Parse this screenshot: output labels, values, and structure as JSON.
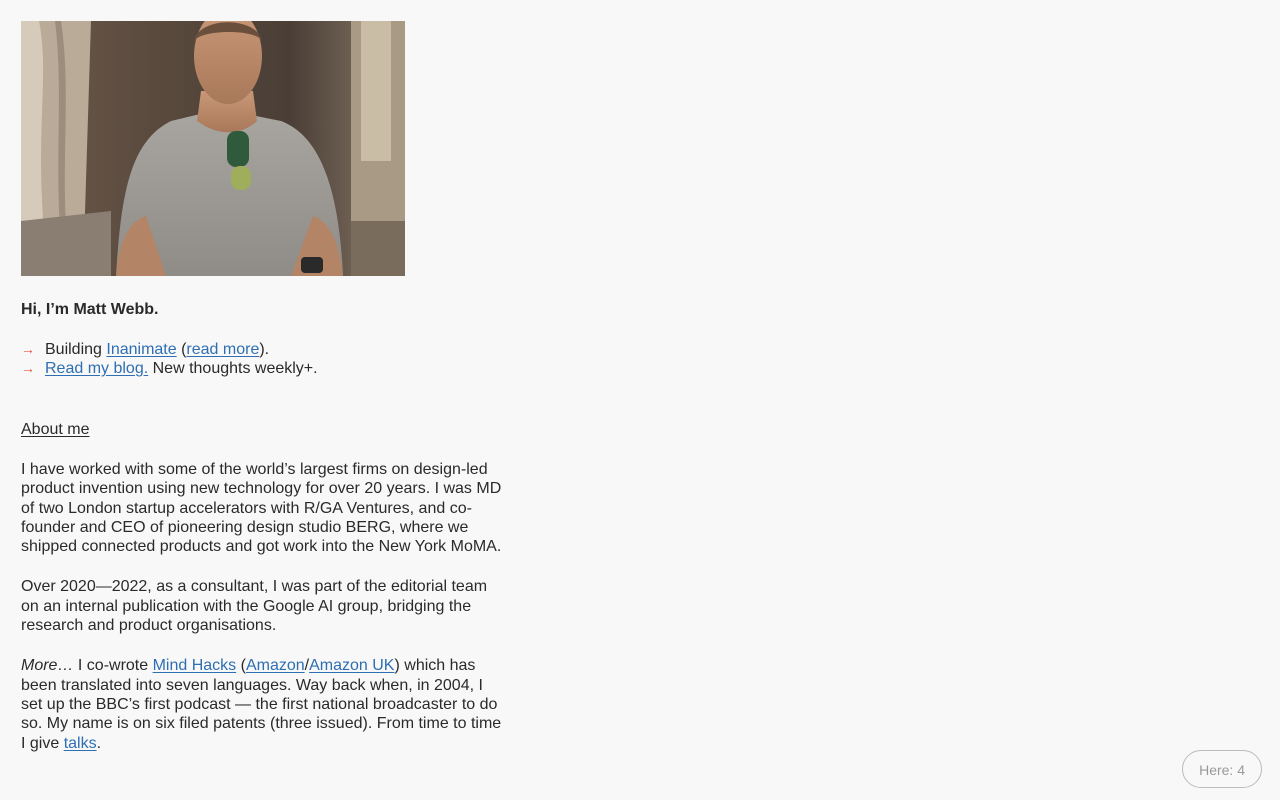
{
  "profile": {
    "photo_alt": "Portrait photo",
    "intro": "Hi, I’m Matt Webb."
  },
  "links": {
    "arrow": "→",
    "item1": {
      "prefix": "Building ",
      "link1": "Inanimate",
      "mid": " (",
      "link2": "read more",
      "suffix": ")."
    },
    "item2": {
      "link": "Read my blog.",
      "suffix": " New thoughts weekly+."
    }
  },
  "about": {
    "heading": "About me",
    "para1": "I have worked with some of the world’s largest firms on design-led product invention using new technology for over 20 years. I was MD of two London startup accelerators with R/GA Ventures, and co-founder and CEO of pioneering design studio BERG, where we shipped connected products and got work into the New York MoMA.",
    "para2": "Over 2020—2022, as a consultant, I was part of the editorial team on an internal publication with the Google AI group, bridging the research and product organisations.",
    "para3": {
      "more": "More…",
      "t1": " I co-wrote ",
      "link_mindhacks": "Mind Hacks",
      "t2": " (",
      "link_amazon": "Amazon",
      "slash": "/",
      "link_amazon_uk": "Amazon UK",
      "t3": ") which has been translated into seven languages. Way back when, in 2004, I set up the BBC’s first podcast — the first national broadcaster to do so. My name is on six filed patents (three issued). From time to time I give ",
      "link_talks": "talks",
      "t4": "."
    }
  },
  "presence": {
    "label": "Here: 4"
  },
  "colors": {
    "background": "#f8f8f8",
    "link": "#2e6fb3",
    "arrow": "#e5533d",
    "text": "#2a2a2a"
  }
}
